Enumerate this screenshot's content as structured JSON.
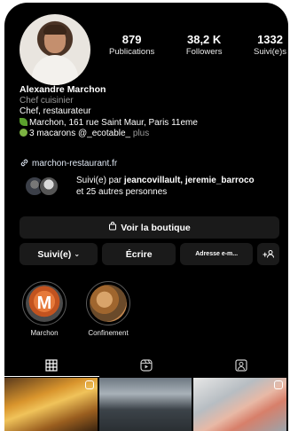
{
  "profile": {
    "stats": [
      {
        "value": "879",
        "label": "Publications"
      },
      {
        "value": "38,2 K",
        "label": "Followers"
      },
      {
        "value": "1332",
        "label": "Suivi(e)s"
      }
    ],
    "name": "Alexandre Marchon",
    "bio_line1": "Chef cuisinier",
    "bio_line2": "Chef, restaurateur",
    "bio_line3": "Marchon, 161 rue Saint Maur, Paris 11eme",
    "bio_line4": "3 macarons @_ecotable_",
    "bio_more": "plus",
    "link": "marchon-restaurant.fr",
    "followed_prefix": "Suivi(e) par",
    "followed_names": "jeancovillault, jeremie_barroco",
    "followed_suffix": "et 25 autres personnes"
  },
  "buttons": {
    "shop": "Voir la boutique",
    "following": "Suivi(e)",
    "message": "Écrire",
    "email": "Adresse e-m...",
    "add_person": "+"
  },
  "highlights": [
    {
      "label": "Marchon",
      "letter": "M"
    },
    {
      "label": "Confinement"
    }
  ],
  "icons": {
    "link": "link-icon",
    "shop": "shopping-bag-icon",
    "grid": "grid-icon",
    "reels": "reels-icon",
    "tagged": "tagged-icon"
  }
}
